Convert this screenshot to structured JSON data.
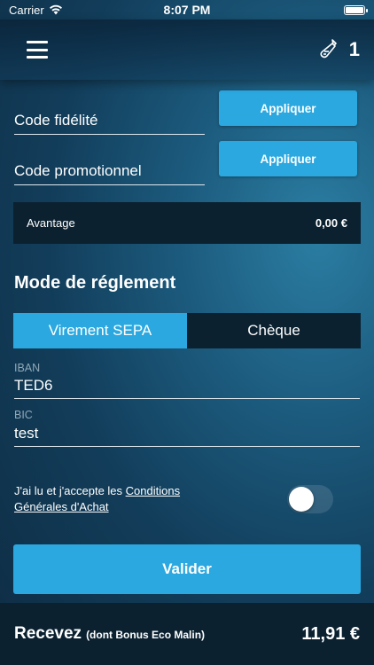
{
  "status_bar": {
    "carrier": "Carrier",
    "time": "8:07 PM"
  },
  "header": {
    "cart_count": "1"
  },
  "loyalty": {
    "label": "Code fidélité",
    "button": "Appliquer"
  },
  "promo": {
    "label": "Code promotionnel",
    "button": "Appliquer"
  },
  "advantage": {
    "label": "Avantage",
    "value": "0,00 €"
  },
  "payment": {
    "title": "Mode de réglement",
    "options": [
      "Virement SEPA",
      "Chèque"
    ],
    "selected": "Virement SEPA",
    "iban_label": "IBAN",
    "iban_value": "TED6",
    "bic_label": "BIC",
    "bic_value": "test"
  },
  "terms": {
    "prefix": "J'ai lu et j'accepte les ",
    "link": "Conditions Générales d'Achat",
    "accepted": false
  },
  "submit_label": "Valider",
  "footer": {
    "receive": "Recevez",
    "receive_detail": "(dont Bonus Eco Malin)",
    "total": "11,91 €"
  },
  "colors": {
    "accent": "#2aa8df",
    "panel": "#0b2130"
  }
}
